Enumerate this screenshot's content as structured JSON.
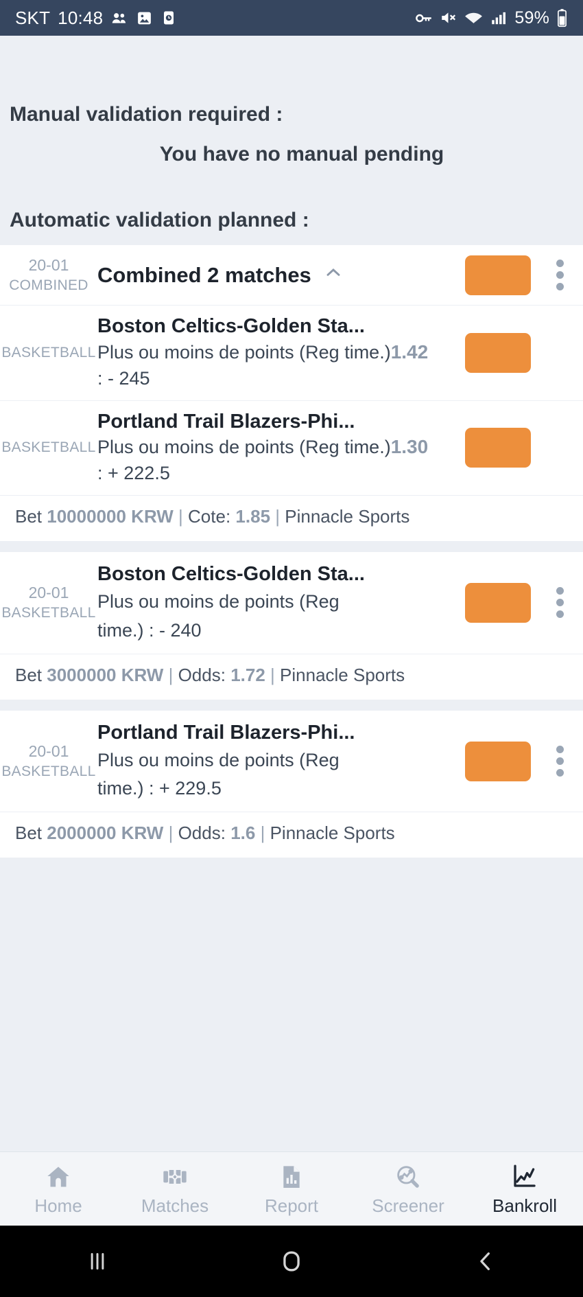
{
  "statusbar": {
    "carrier": "SKT",
    "time": "10:48",
    "battery": "59%",
    "left_icons": [
      "contacts-icon",
      "photo-icon",
      "clock-icon"
    ],
    "right_icons": [
      "vpn-key-icon",
      "mute-icon",
      "wifi-icon",
      "signal-icon"
    ]
  },
  "manual": {
    "heading": "Manual validation required :",
    "message": "You have no manual pending"
  },
  "automatic": {
    "heading": "Automatic validation planned :"
  },
  "cards": [
    {
      "date": "20-01",
      "sport": "COMBINED",
      "title": "Combined 2 matches",
      "collapse_icon": "chevron-up-icon",
      "legs": [
        {
          "sport": "BASKETBALL",
          "title": "Boston Celtics-Golden Sta...",
          "market": "Plus ou moins de points (Reg time.) : - 245",
          "market_line1": "Plus ou moins de points (Reg time.)",
          "market_line2": ": - 245",
          "odds": "1.42"
        },
        {
          "sport": "BASKETBALL",
          "title": "Portland Trail Blazers-Phi...",
          "market": "Plus ou moins de points (Reg time.) : + 222.5",
          "market_line1": "Plus ou moins de points (Reg time.)",
          "market_line2": ": + 222.5",
          "odds": "1.30"
        }
      ],
      "bet": {
        "prefix": "Bet",
        "stake": "10000000 KRW",
        "odds_label": "Cote:",
        "odds": "1.85",
        "bookmaker": "Pinnacle Sports"
      }
    },
    {
      "date": "20-01",
      "sport": "BASKETBALL",
      "title": "Boston Celtics-Golden Sta...",
      "market_line1": "Plus ou moins de points (Reg",
      "market_line2": "time.) : - 240",
      "bet": {
        "prefix": "Bet",
        "stake": "3000000 KRW",
        "odds_label": "Odds:",
        "odds": "1.72",
        "bookmaker": "Pinnacle Sports"
      }
    },
    {
      "date": "20-01",
      "sport": "BASKETBALL",
      "title": "Portland Trail Blazers-Phi...",
      "market_line1": "Plus ou moins de points (Reg",
      "market_line2": "time.) : + 229.5",
      "bet": {
        "prefix": "Bet",
        "stake": "2000000 KRW",
        "odds_label": "Odds:",
        "odds": "1.6",
        "bookmaker": "Pinnacle Sports"
      }
    }
  ],
  "bottom_nav": [
    {
      "label": "Home",
      "icon": "home-icon",
      "active": false
    },
    {
      "label": "Matches",
      "icon": "matches-icon",
      "active": false
    },
    {
      "label": "Report",
      "icon": "report-icon",
      "active": false
    },
    {
      "label": "Screener",
      "icon": "screener-icon",
      "active": false
    },
    {
      "label": "Bankroll",
      "icon": "bankroll-icon",
      "active": true
    }
  ],
  "android_nav": {
    "recents": "recents-icon",
    "home": "home-circle-icon",
    "back": "back-icon"
  },
  "colors": {
    "accent_orange": "#ed8f3c",
    "statusbar": "#36465f",
    "page_bg": "#eceff4",
    "muted": "#9aa6b5"
  },
  "separators": {
    "pipe": "|"
  }
}
